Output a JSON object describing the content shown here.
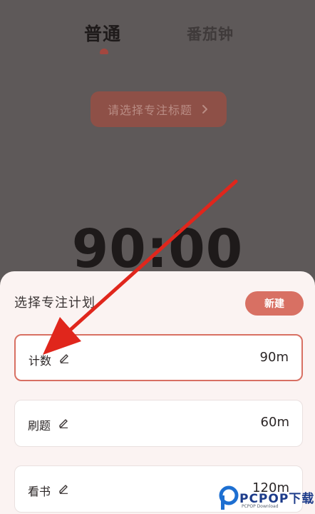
{
  "tabs": {
    "normal": "普通",
    "pomodoro": "番茄钟"
  },
  "select_title_button": "请选择专注标题",
  "timer": "90:00",
  "sheet": {
    "title": "选择专注计划",
    "new_button": "新建",
    "plans": [
      {
        "name": "计数",
        "duration": "90m"
      },
      {
        "name": "刷题",
        "duration": "60m"
      },
      {
        "name": "看书",
        "duration": "120m"
      }
    ]
  },
  "watermark": {
    "text": "PCPOP下载",
    "sub": "PCPOP Download"
  },
  "colors": {
    "accent": "#d87063",
    "annotation_arrow": "#e0261c",
    "overlay": "#5e5959"
  },
  "icons": [
    "chevron-right-icon",
    "edit-icon",
    "annotation-arrow",
    "pcpop-logo-icon"
  ]
}
